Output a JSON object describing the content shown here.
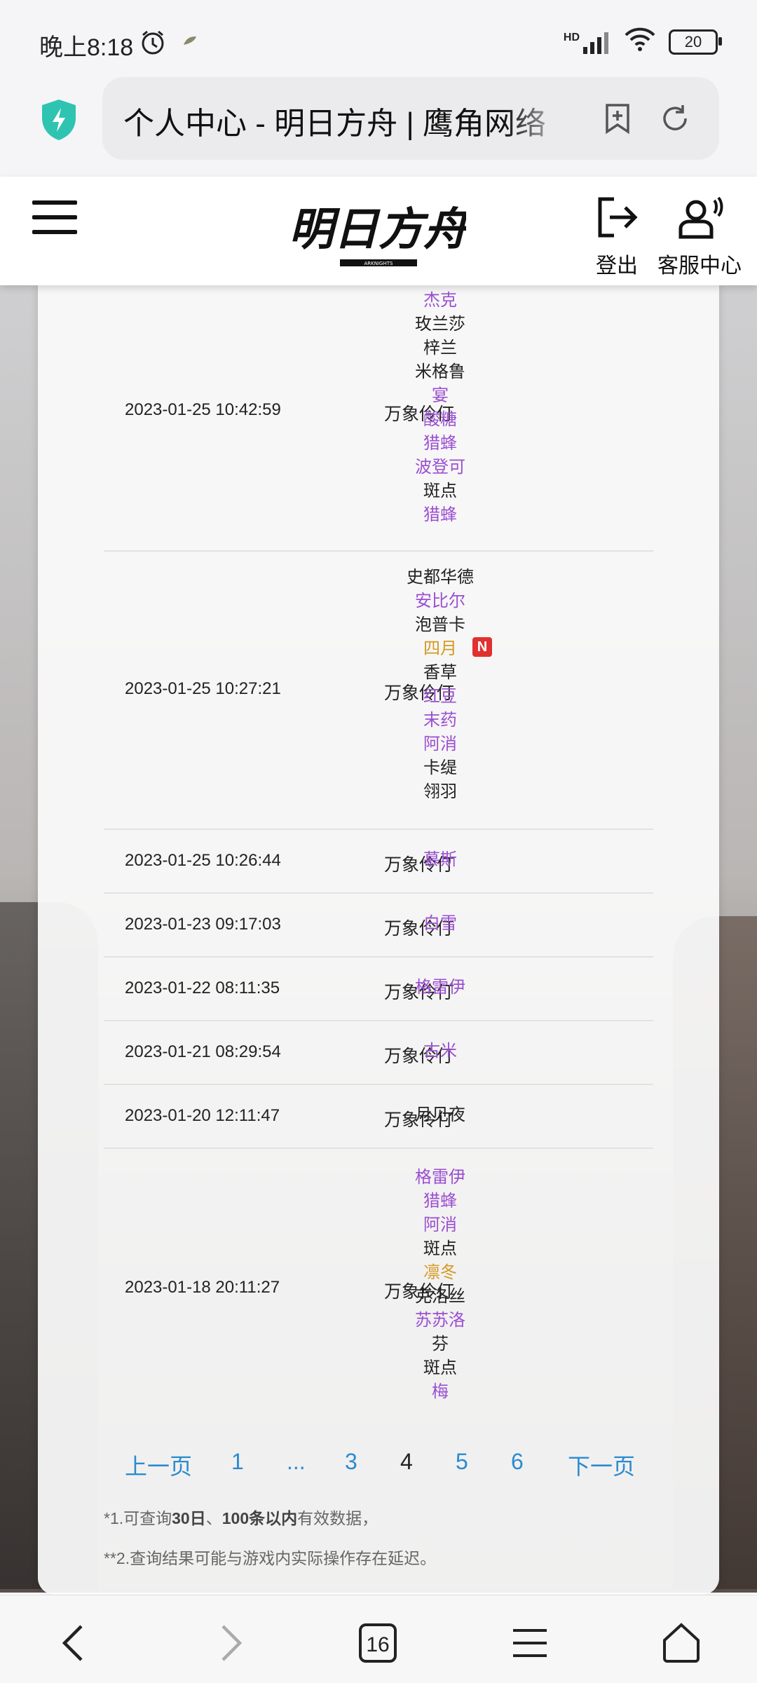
{
  "status": {
    "time": "晚上8:18",
    "network": "HD",
    "battery": "20"
  },
  "browser": {
    "url_title": "个人中心 - 明日方舟 | 鹰角网络",
    "tabs_count": "16"
  },
  "header": {
    "logo_text": "明日方舟",
    "logo_subtext": "ARKNIGHTS",
    "logout_label": "登出",
    "support_label": "客服中心"
  },
  "records": [
    {
      "time": "2023-01-25 10:42:59",
      "pool": "万象伶仃",
      "chars": [
        {
          "name": "杰克",
          "rarity": "purple"
        },
        {
          "name": "玫兰莎",
          "rarity": "black"
        },
        {
          "name": "梓兰",
          "rarity": "black"
        },
        {
          "name": "米格鲁",
          "rarity": "black"
        },
        {
          "name": "宴",
          "rarity": "purple"
        },
        {
          "name": "酸糖",
          "rarity": "purple"
        },
        {
          "name": "猎蜂",
          "rarity": "purple"
        },
        {
          "name": "波登可",
          "rarity": "purple"
        },
        {
          "name": "斑点",
          "rarity": "black"
        },
        {
          "name": "猎蜂",
          "rarity": "purple"
        }
      ]
    },
    {
      "time": "2023-01-25 10:27:21",
      "pool": "万象伶仃",
      "chars": [
        {
          "name": "史都华德",
          "rarity": "black"
        },
        {
          "name": "安比尔",
          "rarity": "purple"
        },
        {
          "name": "泡普卡",
          "rarity": "black"
        },
        {
          "name": "四月",
          "rarity": "gold",
          "badge": "N"
        },
        {
          "name": "香草",
          "rarity": "black"
        },
        {
          "name": "红豆",
          "rarity": "purple"
        },
        {
          "name": "末药",
          "rarity": "purple"
        },
        {
          "name": "阿消",
          "rarity": "purple"
        },
        {
          "name": "卡缇",
          "rarity": "black"
        },
        {
          "name": "翎羽",
          "rarity": "black"
        }
      ]
    },
    {
      "time": "2023-01-25 10:26:44",
      "pool": "万象伶仃",
      "chars": [
        {
          "name": "慕斯",
          "rarity": "purple"
        }
      ]
    },
    {
      "time": "2023-01-23 09:17:03",
      "pool": "万象伶仃",
      "chars": [
        {
          "name": "白雪",
          "rarity": "purple"
        }
      ]
    },
    {
      "time": "2023-01-22 08:11:35",
      "pool": "万象伶仃",
      "chars": [
        {
          "name": "格雷伊",
          "rarity": "purple"
        }
      ]
    },
    {
      "time": "2023-01-21 08:29:54",
      "pool": "万象伶仃",
      "chars": [
        {
          "name": "古米",
          "rarity": "purple"
        }
      ]
    },
    {
      "time": "2023-01-20 12:11:47",
      "pool": "万象伶仃",
      "chars": [
        {
          "name": "月见夜",
          "rarity": "black"
        }
      ]
    },
    {
      "time": "2023-01-18 20:11:27",
      "pool": "万象伶仃",
      "chars": [
        {
          "name": "格雷伊",
          "rarity": "purple"
        },
        {
          "name": "猎蜂",
          "rarity": "purple"
        },
        {
          "name": "阿消",
          "rarity": "purple"
        },
        {
          "name": "斑点",
          "rarity": "black"
        },
        {
          "name": "凛冬",
          "rarity": "gold"
        },
        {
          "name": "克洛丝",
          "rarity": "black"
        },
        {
          "name": "苏苏洛",
          "rarity": "purple"
        },
        {
          "name": "芬",
          "rarity": "black"
        },
        {
          "name": "斑点",
          "rarity": "black"
        },
        {
          "name": "梅",
          "rarity": "purple"
        }
      ]
    }
  ],
  "pager": {
    "prev": "上一页",
    "p1": "1",
    "ellipsis": "...",
    "p3": "3",
    "p4": "4",
    "p5": "5",
    "p6": "6",
    "next": "下一页",
    "current": "4"
  },
  "notes": {
    "n1_prefix": "*1.可查询",
    "n1_bold1": "30日",
    "n1_sep": "、",
    "n1_bold2": "100条以内",
    "n1_suffix": "有效数据，",
    "n2": "**2.查询结果可能与游戏内实际操作存在延迟。"
  },
  "colors": {
    "purple": "#9b4fd1",
    "gold": "#d39a22",
    "link": "#2a8bd0",
    "badge": "#e03131"
  }
}
